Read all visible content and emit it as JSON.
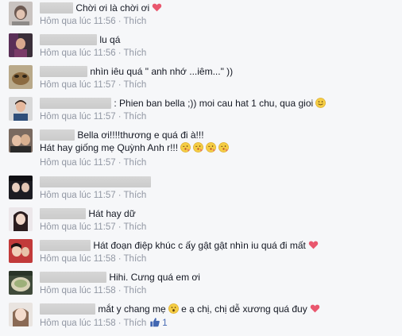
{
  "comments": [
    {
      "text": "Chời ơi là chời ơi",
      "time": "Hôm qua lúc 11:56",
      "like_label": "Thích",
      "emojis": [
        "heart"
      ]
    },
    {
      "text": "lu qá",
      "time": "Hôm qua lúc 11:56",
      "like_label": "Thích",
      "emojis": []
    },
    {
      "text": "nhìn iêu quá \" anh nhớ ...iêm...\" ))",
      "time": "Hôm qua lúc 11:57",
      "like_label": "Thích",
      "emojis": []
    },
    {
      "text": ": Phien ban bella ;)) moi cau hat 1 chu, qua gioi",
      "time": "Hôm qua lúc 11:57",
      "like_label": "Thích",
      "emojis": [
        "smile"
      ]
    },
    {
      "text": "Bella ơi!!!!thương e quá đi à!!!",
      "text2": "Hát hay giống mẹ Quỳnh Anh r!!!",
      "time": "Hôm qua lúc 11:57",
      "like_label": "Thích",
      "emojis": [
        "kiss",
        "kiss",
        "kiss",
        "kiss"
      ]
    },
    {
      "text": "",
      "time": "Hôm qua lúc 11:57",
      "like_label": "Thích",
      "emojis": []
    },
    {
      "text": "Hát hay dữ",
      "time": "Hôm qua lúc 11:57",
      "like_label": "Thích",
      "emojis": []
    },
    {
      "text": "Hát đoạn điệp khúc c ấy gật gật nhìn iu quá đi mất",
      "time": "Hôm qua lúc 11:58",
      "like_label": "Thích",
      "emojis": [
        "heart"
      ]
    },
    {
      "text": "Hihi. Cưng quá em ơi",
      "time": "Hôm qua lúc 11:58",
      "like_label": "Thích",
      "emojis": []
    },
    {
      "text": "mắt y chang mẹ",
      "text_b": "e ạ chị, chị dễ xương quá đuy",
      "time": "Hôm qua lúc 11:58",
      "like_label": "Thích",
      "like_count": "1",
      "emojis": [
        "surprised",
        "heart"
      ]
    }
  ]
}
